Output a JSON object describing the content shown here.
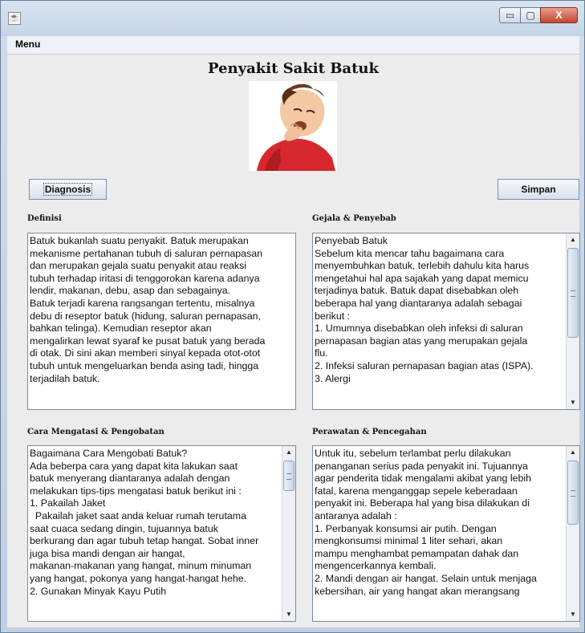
{
  "window": {
    "minimize_glyph": "▭",
    "maximize_glyph": "▢",
    "close_glyph": "X",
    "app_icon": "java-app-icon"
  },
  "menu": {
    "label": "Menu"
  },
  "header": {
    "title": "Penyakit Sakit Batuk"
  },
  "buttons": {
    "diagnosis": "Diagnosis",
    "simpan": "Simpan"
  },
  "sections": {
    "definisi": {
      "label": "Definisi",
      "text": "Batuk bukanlah suatu penyakit. Batuk merupakan\nmekanisme pertahanan tubuh di saluran pernapasan\ndan merupakan gejala suatu penyakit atau reaksi\ntubuh terhadap iritasi di tenggorokan karena adanya\nlendir, makanan, debu, asap dan sebagainya.\nBatuk terjadi karena rangsangan tertentu, misalnya\ndebu di reseptor batuk (hidung, saluran pernapasan,\nbahkan telinga). Kemudian reseptor akan\nmengalirkan lewat syaraf ke pusat batuk yang berada\ndi otak. Di sini akan memberi sinyal kepada otot-otot\ntubuh untuk mengeluarkan benda asing tadi, hingga\nterjadilah batuk."
    },
    "gejala": {
      "label": "Gejala & Penyebab",
      "text": "Penyebab Batuk\nSebelum kita mencar tahu bagaimana cara\nmenyembuhkan batuk, terlebih dahulu kita harus\nmengetahui hal apa sajakah yang dapat memicu\nterjadinya batuk. Batuk dapat disebabkan oleh\nbeberapa hal yang diantaranya adalah sebagai\nberikut :\n1. Umumnya disebabkan oleh infeksi di saluran\npernapasan bagian atas yang merupakan gejala\nflu.\n2. Infeksi saluran pernapasan bagian atas (ISPA).\n3. Alergi"
    },
    "cara": {
      "label": "Cara Mengatasi & Pengobatan",
      "text": "Bagaimana Cara Mengobati Batuk?\nAda beberpa cara yang dapat kita lakukan saat\nbatuk menyerang diantaranya adalah dengan\nmelakukan tips-tips mengatasi batuk berikut ini :\n1. Pakailah Jaket\n  Pakailah jaket saat anda keluar rumah terutama\nsaat cuaca sedang dingin, tujuannya batuk\nberkurang dan agar tubuh tetap hangat. Sobat inner\njuga bisa mandi dengan air hangat,\nmakanan-makanan yang hangat, minum minuman\nyang hangat, pokonya yang hangat-hangat hehe.\n2. Gunakan Minyak Kayu Putih"
    },
    "perawatan": {
      "label": "Perawatan & Pencegahan",
      "text": "Untuk itu, sebelum terlambat perlu dilakukan\npenanganan serius pada penyakit ini. Tujuannya\nagar penderita tidak mengalami akibat yang lebih\nfatal, karena menganggap sepele keberadaan\npenyakit ini. Beberapa hal yang bisa dilakukan di\nantaranya adalah :\n1. Perbanyak konsumsi air putih. Dengan\nmengkonsumsi minimal 1 liter sehari, akan\nmampu menghambat pemampatan dahak dan\nmengencerkannya kembali.\n2. Mandi dengan air hangat. Selain untuk menjaga\nkebersihan, air yang hangat akan merangsang"
    }
  }
}
